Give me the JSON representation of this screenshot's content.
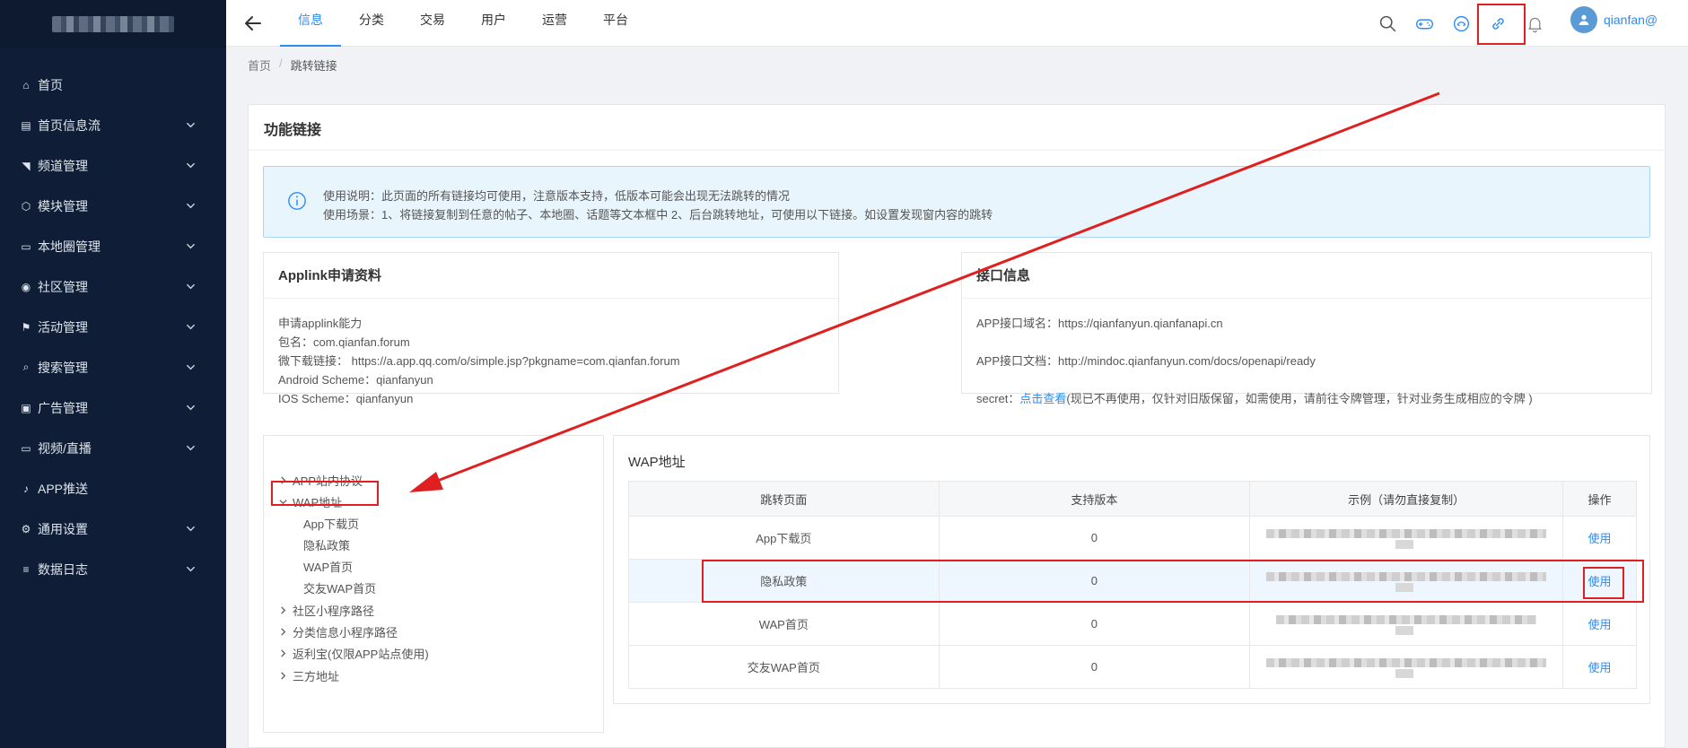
{
  "sidebar": {
    "items": [
      {
        "label": "首页",
        "icon": "home-icon",
        "glyph": "⌂",
        "expandable": false
      },
      {
        "label": "首页信息流",
        "icon": "list-icon",
        "glyph": "▤",
        "expandable": true
      },
      {
        "label": "频道管理",
        "icon": "rss-icon",
        "glyph": "◥",
        "expandable": true
      },
      {
        "label": "模块管理",
        "icon": "cube-icon",
        "glyph": "⬡",
        "expandable": true
      },
      {
        "label": "本地圈管理",
        "icon": "card-icon",
        "glyph": "▭",
        "expandable": true
      },
      {
        "label": "社区管理",
        "icon": "user-circle-icon",
        "glyph": "◉",
        "expandable": true
      },
      {
        "label": "活动管理",
        "icon": "flag-icon",
        "glyph": "⚑",
        "expandable": true
      },
      {
        "label": "搜索管理",
        "icon": "search-icon",
        "glyph": "⌕",
        "expandable": true
      },
      {
        "label": "广告管理",
        "icon": "image-icon",
        "glyph": "▣",
        "expandable": true
      },
      {
        "label": "视频/直播",
        "icon": "tv-icon",
        "glyph": "▭",
        "expandable": true
      },
      {
        "label": "APP推送",
        "icon": "bell-icon",
        "glyph": "♪",
        "expandable": false
      },
      {
        "label": "通用设置",
        "icon": "gear-icon",
        "glyph": "⚙",
        "expandable": true
      },
      {
        "label": "数据日志",
        "icon": "lines-icon",
        "glyph": "≡",
        "expandable": true
      }
    ]
  },
  "topbar": {
    "tabs": [
      "信息",
      "分类",
      "交易",
      "用户",
      "运营",
      "平台"
    ],
    "active_tab": 0,
    "username": "qianfan@"
  },
  "breadcrumb": {
    "home": "首页",
    "separator": "/",
    "current": "跳转链接"
  },
  "card": {
    "title": "功能链接",
    "notice": {
      "line1": "使用说明：此页面的所有链接均可使用，注意版本支持，低版本可能会出现无法跳转的情况",
      "line2": "使用场景：1、将链接复制到任意的帖子、本地圈、话题等文本框中 2、后台跳转地址，可使用以下链接。如设置发现窗内容的跳转"
    },
    "applink": {
      "title": "Applink申请资料",
      "lines": [
        "申请applink能力",
        "包名：com.qianfan.forum",
        "微下载链接： https://a.app.qq.com/o/simple.jsp?pkgname=com.qianfan.forum",
        "Android Scheme：qianfanyun",
        "IOS Scheme：qianfanyun"
      ]
    },
    "api": {
      "title": "接口信息",
      "domain": "APP接口域名：https://qianfanyun.qianfanapi.cn",
      "doc": "APP接口文档：http://mindoc.qianfanyun.com/docs/openapi/ready",
      "secret_prefix": "secret：",
      "secret_link": "点击查看",
      "secret_suffix": "(现已不再使用，仅针对旧版保留，如需使用，请前往令牌管理，针对业务生成相应的令牌 )"
    },
    "tree": [
      {
        "label": "APP站内协议",
        "level": 0,
        "expanded": false
      },
      {
        "label": "WAP地址",
        "level": 0,
        "expanded": true
      },
      {
        "label": "App下载页",
        "level": 1
      },
      {
        "label": "隐私政策",
        "level": 1
      },
      {
        "label": "WAP首页",
        "level": 1
      },
      {
        "label": "交友WAP首页",
        "level": 1
      },
      {
        "label": "社区小程序路径",
        "level": 0,
        "expanded": false
      },
      {
        "label": "分类信息小程序路径",
        "level": 0,
        "expanded": false
      },
      {
        "label": "返利宝(仅限APP站点使用)",
        "level": 0,
        "expanded": false
      },
      {
        "label": "三方地址",
        "level": 0,
        "expanded": false
      }
    ],
    "wap": {
      "title": "WAP地址",
      "columns": [
        "跳转页面",
        "支持版本",
        "示例（请勿直接复制）",
        "操作"
      ],
      "rows": [
        {
          "page": "App下载页",
          "version": "0",
          "action": "使用"
        },
        {
          "page": "隐私政策",
          "version": "0",
          "action": "使用"
        },
        {
          "page": "WAP首页",
          "version": "0",
          "action": "使用"
        },
        {
          "page": "交友WAP首页",
          "version": "0",
          "action": "使用"
        }
      ]
    }
  },
  "colors": {
    "accent": "#2d8cf0",
    "sidebar_bg": "#0f1e36",
    "annotation": "#e02020"
  }
}
